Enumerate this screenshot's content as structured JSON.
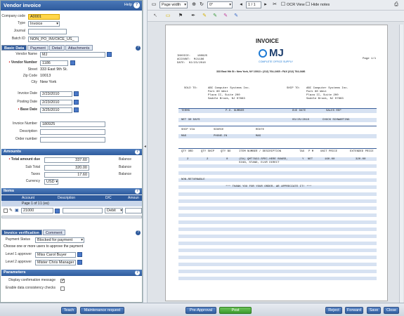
{
  "left": {
    "title": "Vendor invoice",
    "help": "Help",
    "company_code_label": "Company code",
    "company_code": "A0001",
    "type_label": "Type",
    "type": "Invoice",
    "journal_label": "Journal",
    "journal": "",
    "batch_label": "Batch ID",
    "batch": "NON_PO_INVOICE_US_",
    "tabs": [
      "Basic Data",
      "Payment",
      "Detail",
      "Attachments"
    ],
    "vendor_name_label": "Vendor Name",
    "vendor_name": "MJ",
    "vendor_number_label": "Vendor Number",
    "vendor_number": "1186",
    "street_label": "Street",
    "street": "333 East 9th St.",
    "zip_label": "Zip Code",
    "zip": "10013",
    "city_label": "City",
    "city": "New York",
    "invoice_date_label": "Invoice Date",
    "invoice_date": "2/23/2010",
    "posting_date_label": "Posting Date",
    "posting_date": "2/23/2010",
    "base_date_label": "Base Date",
    "base_date": "3/25/2010",
    "invoice_number_label": "Invoice Number",
    "invoice_number": "180925",
    "description_label": "Description",
    "order_number_label": "Order number",
    "amounts_title": "Amounts",
    "total_label": "Total amount due",
    "total": "337.60",
    "subtotal_label": "Sub Total",
    "subtotal": "320.00",
    "taxes_label": "Taxes",
    "taxes": "17.60",
    "currency_label": "Currency",
    "currency": "USD",
    "balance_label": "Balance",
    "items_title": "Items",
    "items_headers": [
      "Account",
      "Description",
      "D/C",
      "Amoun"
    ],
    "items_pager": "Page 1 of 1",
    "items_pager_suffix": "1 (es)",
    "item_account": "21000",
    "item_dc": "Debit",
    "verification_tabs": [
      "Invoice verification",
      "Comment"
    ],
    "payment_status_label": "Payment Status",
    "payment_status": "Blocked for payment",
    "approve_text": "Choose one or more users to approve the payment",
    "level1_label": "Level 1 approver",
    "level1": "Miss Carol Buyer",
    "level2_label": "Level 2 approver",
    "level2": "Mister Chris Manager",
    "parameters_title": "Parameters",
    "display_confirm_label": "Display confirmation message",
    "display_confirm": true,
    "consistency_label": "Enable data consistency checks",
    "consistency": false
  },
  "viewer": {
    "zoom_mode": "Page width",
    "rotation": "0°",
    "page_nav": "1 / 1",
    "ocr_label": "OCR View",
    "hide_notes_label": "Hide notes"
  },
  "invoice": {
    "heading": "INVOICE",
    "invoice_no": "INVOICE:    180925",
    "account": "ACCOUNT:  MJ1186",
    "date": "DATE:  02/23/2010",
    "page": "Page 1/1",
    "logo_text": "MJ",
    "logo_sub": "COMPLETE OFFICE SUPPLY",
    "address_line": "333 East 9th St • New York, NY 10013 • (212) 764-2465 • FAX (212) 764-2486",
    "sold_to_label": "SOLD TO:",
    "ship_to_label": "SHIP TO:",
    "sold_to": [
      "ABC Computer Systems Inc.",
      "Park 80 West",
      "Plaza II, Suite 200",
      "Saddle Brook, NJ 07663"
    ],
    "ship_to": [
      "ABC Computer Systems Inc.",
      "Park 80 West",
      "Plaza II, Suite 200",
      "Saddle Brook, NJ 07663"
    ],
    "terms_headers": [
      "TERMS",
      "P.O. NUMBER",
      "DUE DATE",
      "SALES REP"
    ],
    "terms_values": [
      "NET 30 DAYS",
      "03/25/2010",
      "CHUCK SCHWARTING"
    ],
    "ship_headers": [
      "SHIP VIA",
      "SOURCE",
      "ROUTE"
    ],
    "ship_values": [
      "MAS",
      "PHONE-IN",
      "MAS"
    ],
    "item_headers": [
      "QTY ORD",
      "QTY SHIP",
      "QTY BO",
      "ITEM NUMBER / DESCRIPTION",
      "TAX",
      "P M",
      "UNIT PRICE",
      "EXTENDED PRICE"
    ],
    "item_row": [
      "2",
      "2",
      "0",
      "(EA) QMT7822-SPEC-HERE BOARD, SIGN, STAND, ELVR DIRECT",
      "Y",
      "NET",
      "160.00",
      "320.00"
    ],
    "non_returnable": "NON-RETURNABLE",
    "thank_you": "*** THANK YOU FOR YOUR ORDER. WE APPRECIATE IT! ***"
  },
  "buttons": {
    "teach": "Teach",
    "maintenance": "Maintenance request",
    "pre_approval": "Pre-Approval",
    "post": "Post",
    "reject": "Reject",
    "forward": "Forward",
    "save": "Save",
    "close": "Close"
  },
  "colors": {
    "accent": "#2e5a9c",
    "post": "#3b9a2c",
    "highlight": "#ffd64a"
  }
}
